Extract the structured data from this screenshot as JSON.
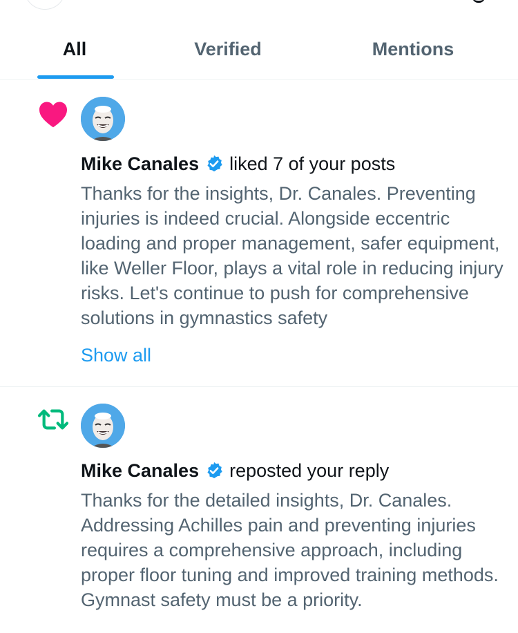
{
  "tabs": [
    {
      "label": "All",
      "active": true
    },
    {
      "label": "Verified",
      "active": false
    },
    {
      "label": "Mentions",
      "active": false
    }
  ],
  "colors": {
    "accent": "#1d9bf0",
    "like": "#f91880",
    "repost": "#00ba7c",
    "text_primary": "#0f1419",
    "text_secondary": "#536471"
  },
  "notifications": [
    {
      "type_icon": "heart-icon",
      "name": "Mike Canales",
      "verified_icon": "verified-badge-icon",
      "action": "liked 7 of your posts",
      "body": "Thanks for the insights, Dr. Canales. Preventing injuries is indeed crucial. Alongside eccentric loading and proper management, safer equipment, like Weller Floor, plays a vital role in reducing injury risks. Let's continue to push for comprehensive solutions in gymnastics safety",
      "show_all": "Show all"
    },
    {
      "type_icon": "repost-icon",
      "name": "Mike Canales",
      "verified_icon": "verified-badge-icon",
      "action": "reposted your reply",
      "body": "Thanks for the detailed insights, Dr. Canales. Addressing Achilles pain and preventing injuries requires a comprehensive approach, including proper floor tuning and improved training methods. Gymnast safety must be a priority."
    }
  ]
}
